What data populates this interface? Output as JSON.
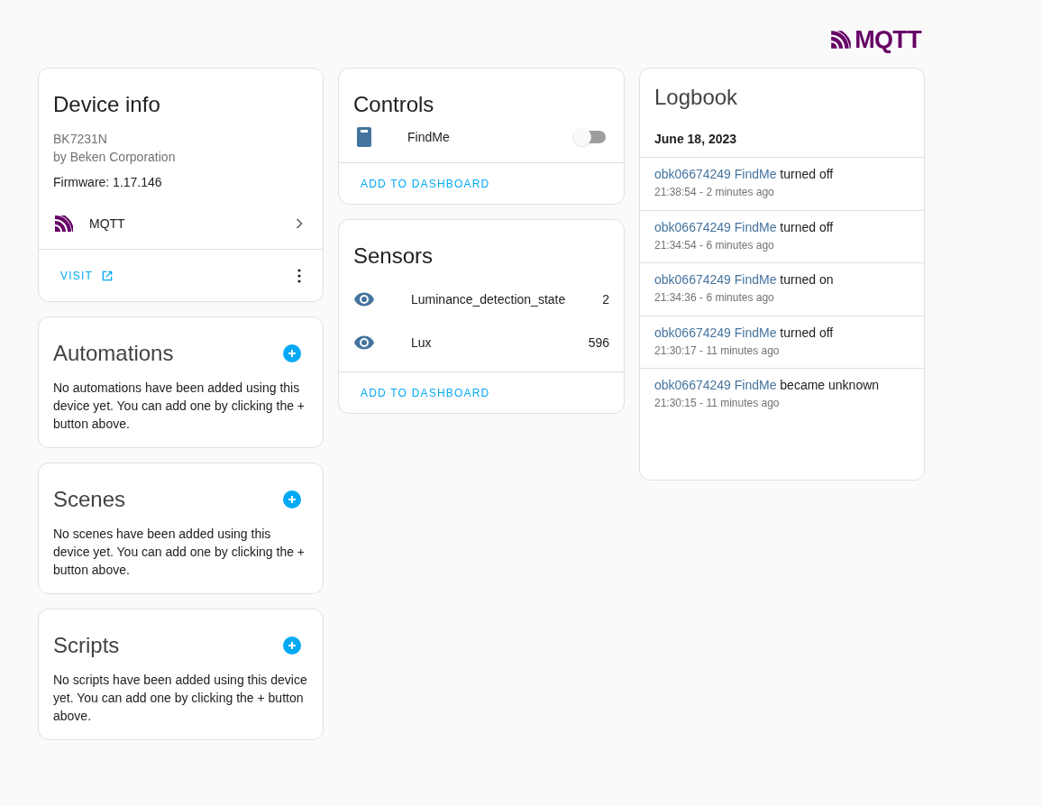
{
  "logo": {
    "text": "MQTT"
  },
  "device_info": {
    "title": "Device info",
    "model": "BK7231N",
    "manufacturer": "by Beken Corporation",
    "firmware": "Firmware: 1.17.146",
    "integration": "MQTT",
    "visit": "VISIT"
  },
  "sections": [
    {
      "title": "Automations",
      "text": "No automations have been added using this device yet. You can add one by clicking the + button above."
    },
    {
      "title": "Scenes",
      "text": "No scenes have been added using this device yet. You can add one by clicking the + button above."
    },
    {
      "title": "Scripts",
      "text": "No scripts have been added using this device yet. You can add one by clicking the + button above."
    }
  ],
  "controls": {
    "title": "Controls",
    "items": [
      {
        "name": "FindMe",
        "on": false
      }
    ],
    "action": "ADD TO DASHBOARD"
  },
  "sensors": {
    "title": "Sensors",
    "items": [
      {
        "name": "Luminance_detection_state",
        "value": "2"
      },
      {
        "name": "Lux",
        "value": "596"
      }
    ],
    "action": "ADD TO DASHBOARD"
  },
  "logbook": {
    "title": "Logbook",
    "date": "June 18, 2023",
    "entries": [
      {
        "entity": "obk06674249 FindMe",
        "message": "turned off",
        "time": "21:38:54 - 2 minutes ago"
      },
      {
        "entity": "obk06674249 FindMe",
        "message": "turned off",
        "time": "21:34:54 - 6 minutes ago"
      },
      {
        "entity": "obk06674249 FindMe",
        "message": "turned on",
        "time": "21:34:36 - 6 minutes ago"
      },
      {
        "entity": "obk06674249 FindMe",
        "message": "turned off",
        "time": "21:30:17 - 11 minutes ago"
      },
      {
        "entity": "obk06674249 FindMe",
        "message": "became unknown",
        "time": "21:30:15 - 11 minutes ago"
      }
    ]
  }
}
